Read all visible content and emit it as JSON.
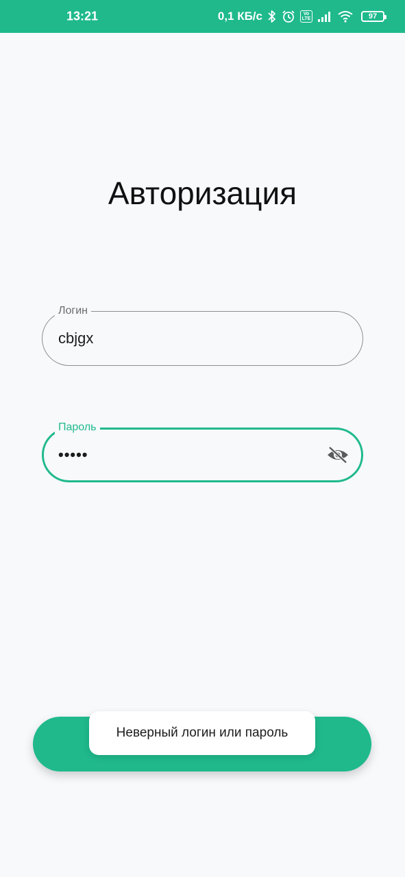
{
  "status_bar": {
    "time": "13:21",
    "network_speed": "0,1 КБ/с",
    "volte_label": "Vo LTE",
    "battery_level": "97",
    "icons": [
      "bluetooth-icon",
      "alarm-icon",
      "volte-icon",
      "signal-icon",
      "wifi-icon",
      "battery-icon"
    ]
  },
  "page": {
    "title": "Авторизация"
  },
  "login_field": {
    "label": "Логин",
    "value": "cbjgx"
  },
  "password_field": {
    "label": "Пароль",
    "value": "•••••",
    "toggle_icon": "eye-off-icon"
  },
  "submit": {
    "label": ""
  },
  "toast": {
    "message": "Неверный логин или пароль"
  },
  "colors": {
    "accent": "#1fb98c",
    "background": "#f7f9fb",
    "status_bar": "#1fb98c"
  }
}
